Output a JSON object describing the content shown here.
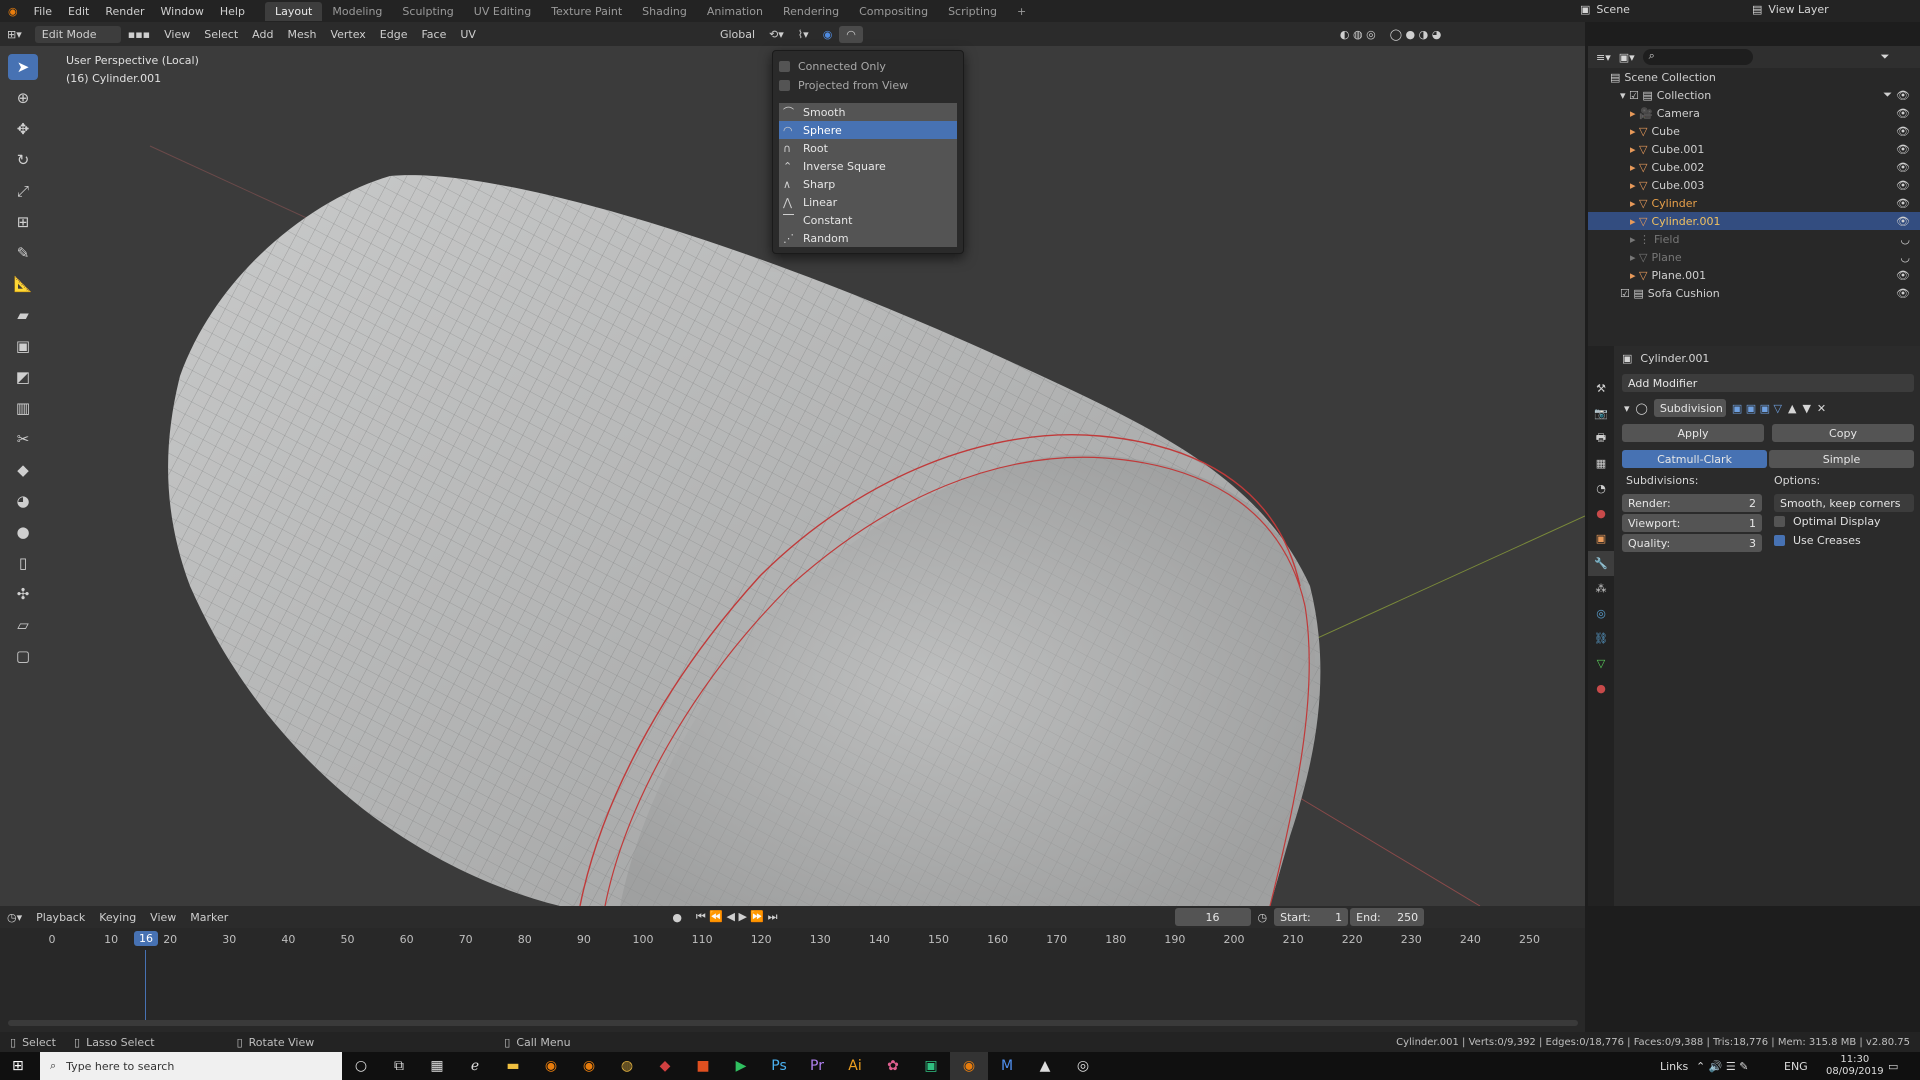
{
  "topbar": {
    "menus": [
      "File",
      "Edit",
      "Render",
      "Window",
      "Help"
    ],
    "workspaces": [
      "Layout",
      "Modeling",
      "Sculpting",
      "UV Editing",
      "Texture Paint",
      "Shading",
      "Animation",
      "Rendering",
      "Compositing",
      "Scripting",
      "+"
    ],
    "active_workspace": "Layout",
    "scene": "Scene",
    "view_layer": "View Layer"
  },
  "viewport_header": {
    "mode": "Edit Mode",
    "menus": [
      "View",
      "Select",
      "Add",
      "Mesh",
      "Vertex",
      "Edge",
      "Face",
      "UV"
    ],
    "orientation": "Global"
  },
  "viewport": {
    "line1": "User Perspective (Local)",
    "line2": "(16) Cylinder.001"
  },
  "falloff_popup": {
    "options": [
      "Connected Only",
      "Projected from View"
    ],
    "items": [
      "Smooth",
      "Sphere",
      "Root",
      "Inverse Square",
      "Sharp",
      "Linear",
      "Constant",
      "Random"
    ],
    "selected": "Sphere"
  },
  "outliner": {
    "root": "Scene Collection",
    "collection": "Collection",
    "items": [
      "Camera",
      "Cube",
      "Cube.001",
      "Cube.002",
      "Cube.003",
      "Cylinder",
      "Cylinder.001",
      "Field",
      "Plane",
      "Plane.001"
    ],
    "extra": "Sofa Cushion"
  },
  "properties": {
    "object": "Cylinder.001",
    "add_modifier": "Add Modifier",
    "modifier_name": "Subdivision",
    "apply": "Apply",
    "copy": "Copy",
    "type_a": "Catmull-Clark",
    "type_b": "Simple",
    "subdivisions_label": "Subdivisions:",
    "options_label": "Options:",
    "render_label": "Render:",
    "render_value": "2",
    "viewport_label": "Viewport:",
    "viewport_value": "1",
    "quality_label": "Quality:",
    "quality_value": "3",
    "uv_smooth": "Smooth, keep corners",
    "optimal_display": "Optimal Display",
    "use_creases": "Use Creases"
  },
  "timeline": {
    "menus": [
      "Playback",
      "Keying",
      "View",
      "Marker"
    ],
    "current_frame": "16",
    "start_label": "Start:",
    "start": "1",
    "end_label": "End:",
    "end": "250",
    "ticks": [
      "0",
      "10",
      "20",
      "30",
      "40",
      "50",
      "60",
      "70",
      "80",
      "90",
      "100",
      "110",
      "120",
      "130",
      "140",
      "150",
      "160",
      "170",
      "180",
      "190",
      "200",
      "210",
      "220",
      "230",
      "240",
      "250"
    ],
    "playhead": "16"
  },
  "statusbar": {
    "select": "Select",
    "lasso": "Lasso Select",
    "rotate": "Rotate View",
    "call_menu": "Call Menu",
    "stats": "Cylinder.001 | Verts:0/9,392 | Edges:0/18,776 | Faces:0/9,388 | Tris:18,776 | Mem: 315.8 MB | v2.80.75"
  },
  "taskbar": {
    "search_placeholder": "Type here to search",
    "links": "Links",
    "lang": "ENG",
    "time": "11:30",
    "date": "08/09/2019"
  }
}
